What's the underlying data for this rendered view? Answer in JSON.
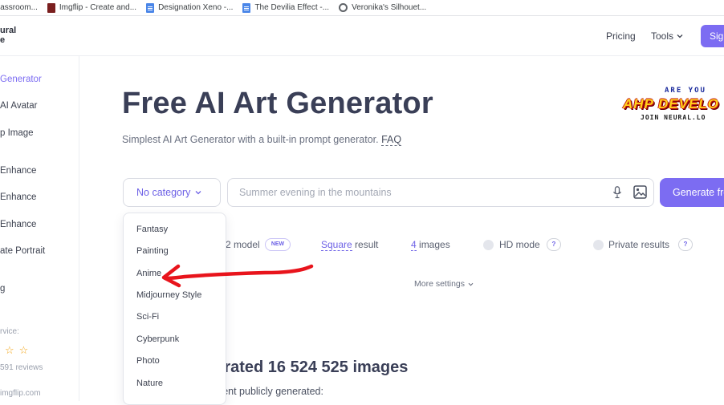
{
  "bookmarks": [
    {
      "label": "lassroom...",
      "icon": "classroom-icon"
    },
    {
      "label": "Imgflip - Create and...",
      "icon": "imgflip-icon"
    },
    {
      "label": "Designation Xeno -...",
      "icon": "doc-icon"
    },
    {
      "label": "The Devilia Effect -...",
      "icon": "doc-icon"
    },
    {
      "label": "Veronika's Silhouet...",
      "icon": "globe-icon"
    }
  ],
  "header": {
    "logo": [
      "ural",
      "e"
    ],
    "pricing": "Pricing",
    "tools": "Tools",
    "signup": "Sign up"
  },
  "sidebar": {
    "items": [
      {
        "label": "Generator",
        "active": true
      },
      {
        "label": "AI Avatar"
      },
      {
        "label": "p Image"
      },
      {
        "label": "Enhance"
      },
      {
        "label": "Enhance"
      },
      {
        "label": "Enhance"
      },
      {
        "label": "ate Portrait"
      },
      {
        "label": "g"
      }
    ],
    "service_label": "rvice:",
    "reviews": "591 reviews",
    "watermark": "imgflip.com"
  },
  "main": {
    "title": "Free AI Art Generator",
    "subtitle": "Simplest AI Art Generator with a built-in prompt generator.",
    "faq": "FAQ",
    "banner": {
      "top": "ARE YOU",
      "mid": "AHP DEVELO",
      "bot": "JOIN NEURAL.LO"
    },
    "category_select": "No category",
    "prompt_placeholder": "Summer evening in the mountains",
    "prompt_value": "",
    "generate_button": "Generate free",
    "options": {
      "model": "2 model",
      "new_badge": "NEW",
      "result": "Square",
      "result_suffix": " result",
      "images_count": "4",
      "images_suffix": " images",
      "hd_mode": "HD mode",
      "private": "Private results",
      "help": "?"
    },
    "more_settings": "More settings",
    "generated_count": "nerated 16 524 525 images",
    "recent_text": "ecent publicly generated:"
  },
  "dropdown": {
    "items": [
      "Fantasy",
      "Painting",
      "Anime",
      "Midjourney Style",
      "Sci-Fi",
      "Cyberpunk",
      "Photo",
      "Nature"
    ]
  },
  "colors": {
    "accent": "#7c6cf2",
    "annotation_arrow": "#e8141c"
  }
}
